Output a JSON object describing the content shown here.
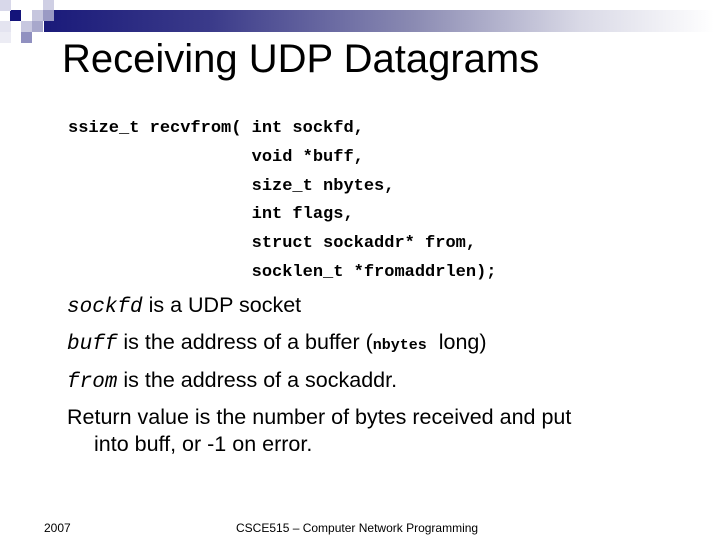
{
  "slide": {
    "title": "Receiving UDP Datagrams",
    "accent_color": "#1a1a7a",
    "code_lines": [
      "ssize_t recvfrom( int sockfd,",
      "                  void *buff,",
      "                  size_t nbytes,",
      "                  int flags,",
      "                  struct sockaddr* from,",
      "                  socklen_t *fromaddrlen);"
    ],
    "bullets": [
      {
        "term": "sockfd",
        "text": " is a UDP socket"
      },
      {
        "term": "buff",
        "text": " is the address of a buffer (",
        "inline_code": "nbytes",
        "text_after": "  long)"
      },
      {
        "term": "from",
        "text": " is the address of a sockaddr."
      },
      {
        "text": "Return value is the number of bytes received and put",
        "continuation": "into buff, or -1 on error."
      }
    ]
  },
  "footer": {
    "year": "2007",
    "course": "CSCE515 – Computer Network Programming"
  }
}
